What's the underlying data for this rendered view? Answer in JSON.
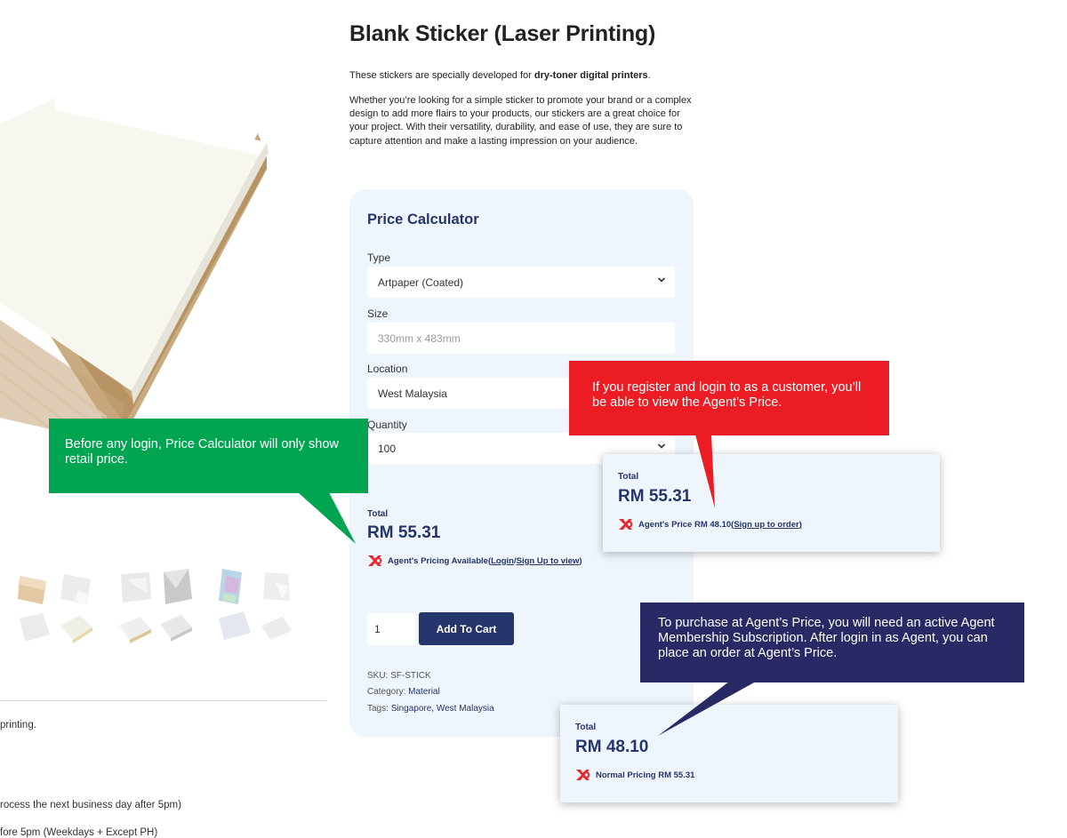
{
  "product": {
    "title": "Blank Sticker (Laser Printing)",
    "intro_prefix": "These stickers are specially developed for ",
    "intro_bold": "dry-toner digital printers",
    "intro_suffix": ".",
    "description": "Whether you’re looking for a simple sticker to promote your brand or a complex design to add more flairs to your products, our stickers are a great choice for your project. With their versatility, durability, and ease of use, they are sure to capture attention and make a lasting impression on your audience."
  },
  "calculator": {
    "title": "Price Calculator",
    "type_label": "Type",
    "type_value": "Artpaper (Coated)",
    "size_label": "Size",
    "size_placeholder": "330mm x 483mm",
    "location_label": "Location",
    "location_value": "West Malaysia",
    "quantity_label": "Quantity",
    "quantity_value": "100",
    "total_label": "Total",
    "total_value": "RM 55.31",
    "agent_text": "Agent's Pricing Available",
    "agent_open": " (",
    "login_link": "Login",
    "slash": " / ",
    "signup_link": "Sign Up to view",
    "agent_close": ")",
    "cart_qty": "1",
    "add_to_cart": "Add To Cart",
    "sku_label": "SKU: ",
    "sku_value": "SF-STICK",
    "category_label": "Category: ",
    "category_value": "Material",
    "tags_label": "Tags: ",
    "tags_value": "Singapore, West Malaysia"
  },
  "left_text": {
    "line1": "printing.",
    "line2": "rocess the next business day after 5pm)",
    "line3": "fore 5pm (Weekdays + Except PH)"
  },
  "customer_card": {
    "total_label": "Total",
    "total_value": "RM 55.31",
    "agent_text": "Agent's Price RM 48.10 ",
    "signup_link": "(Sign up to order)"
  },
  "agent_card": {
    "total_label": "Total",
    "total_value": "RM 48.10",
    "normal_text": "Normal Pricing RM 55.31"
  },
  "callouts": {
    "green": "Before any login, Price Calculator will only show retail price.",
    "red": "If you register and login to as a customer, you’ll be able to view the Agent’s Price.",
    "navy": "To purchase at Agent’s Price, you will need an active Agent Membership Subscription. After login in as Agent, you can place an order at Agent’s Price."
  },
  "icons": {
    "brand_logo": "brand-logo-icon",
    "dropdown": "chevron-down-icon"
  },
  "colors": {
    "navy": "#26356b",
    "callout_green": "#00a451",
    "callout_red": "#ec1c24",
    "callout_navy": "#292965",
    "panel_bg": "#eef5fc",
    "logo_red": "#e8262b"
  }
}
